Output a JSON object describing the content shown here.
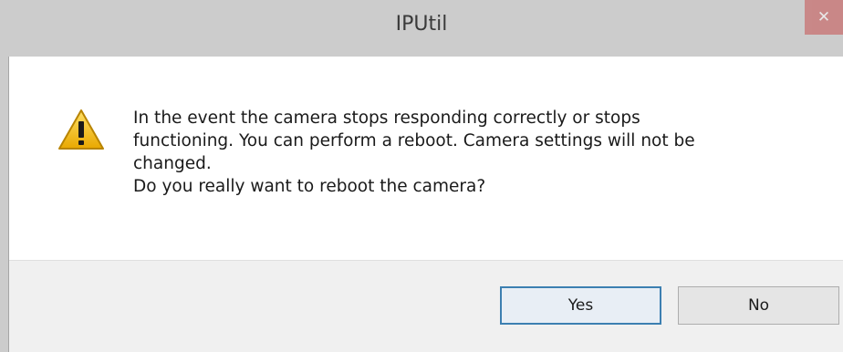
{
  "window": {
    "title": "IPUtil",
    "close_glyph": "✕"
  },
  "dialog": {
    "icon": "warning-icon",
    "message_lines": [
      "In the event the camera stops responding correctly or stops",
      "functioning. You can perform a reboot. Camera settings will not be",
      "changed.",
      "Do you really want to reboot the camera?"
    ]
  },
  "buttons": {
    "yes_label": "Yes",
    "no_label": "No"
  },
  "colors": {
    "close_button": "#c75050",
    "default_button_border": "#3c7fb1",
    "warning_yellow": "#f5c400"
  }
}
